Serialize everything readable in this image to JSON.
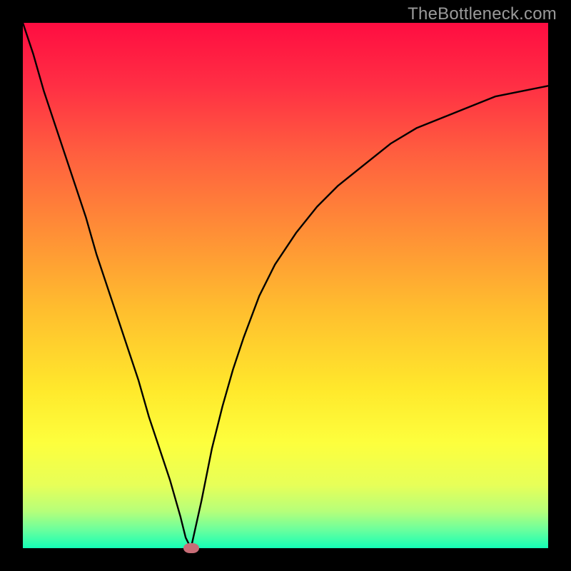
{
  "watermark": "TheBottleneck.com",
  "chart_data": {
    "type": "line",
    "title": "",
    "xlabel": "",
    "ylabel": "",
    "xlim": [
      0,
      100
    ],
    "ylim": [
      0,
      100
    ],
    "grid": false,
    "legend": false,
    "series": [
      {
        "name": "bottleneck-curve",
        "x": [
          0,
          2,
          4,
          6,
          8,
          10,
          12,
          14,
          16,
          18,
          20,
          22,
          24,
          26,
          28,
          30,
          31,
          32,
          34,
          36,
          38,
          40,
          42,
          45,
          48,
          52,
          56,
          60,
          65,
          70,
          75,
          80,
          85,
          90,
          95,
          100
        ],
        "values": [
          100,
          94,
          87,
          81,
          75,
          69,
          63,
          56,
          50,
          44,
          38,
          32,
          25,
          19,
          13,
          6,
          2,
          0,
          9,
          19,
          27,
          34,
          40,
          48,
          54,
          60,
          65,
          69,
          73,
          77,
          80,
          82,
          84,
          86,
          87,
          88
        ]
      }
    ],
    "annotations": [
      {
        "name": "optimum-marker",
        "x": 32,
        "y": 0
      }
    ],
    "background_gradient": {
      "stops": [
        {
          "offset": 0.0,
          "color": "#ff0d41"
        },
        {
          "offset": 0.12,
          "color": "#ff2f44"
        },
        {
          "offset": 0.25,
          "color": "#ff5f3f"
        },
        {
          "offset": 0.4,
          "color": "#ff8f36"
        },
        {
          "offset": 0.55,
          "color": "#ffbf2e"
        },
        {
          "offset": 0.7,
          "color": "#ffe92c"
        },
        {
          "offset": 0.8,
          "color": "#fdff3d"
        },
        {
          "offset": 0.88,
          "color": "#e7ff58"
        },
        {
          "offset": 0.93,
          "color": "#b6ff7a"
        },
        {
          "offset": 0.965,
          "color": "#6bff9d"
        },
        {
          "offset": 1.0,
          "color": "#14ffb6"
        }
      ]
    }
  }
}
